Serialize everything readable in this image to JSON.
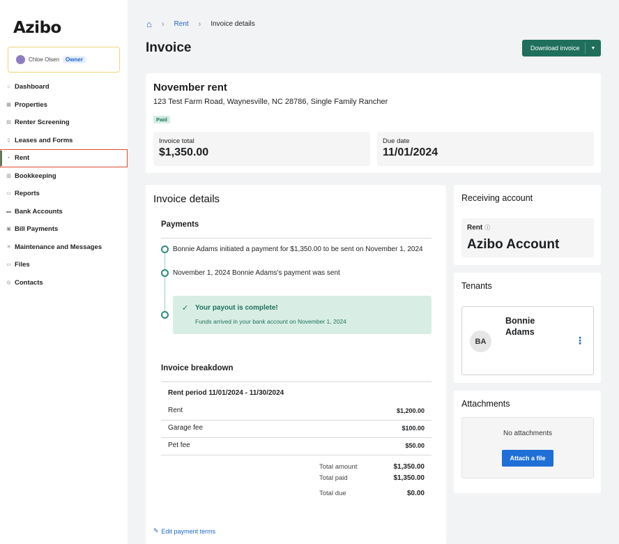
{
  "sidebar": {
    "logo": "Azibo",
    "user_name": "Chloe Olsen",
    "user_role": "Owner",
    "items": [
      {
        "label": "Dashboard",
        "icon": "home-icon"
      },
      {
        "label": "Properties",
        "icon": "building-icon"
      },
      {
        "label": "Renter Screening",
        "icon": "screening-icon"
      },
      {
        "label": "Leases and Forms",
        "icon": "document-icon"
      },
      {
        "label": "Rent",
        "icon": "rent-icon"
      },
      {
        "label": "Bookkeeping",
        "icon": "ledger-icon"
      },
      {
        "label": "Reports",
        "icon": "report-icon"
      },
      {
        "label": "Bank Accounts",
        "icon": "bank-icon"
      },
      {
        "label": "Bill Payments",
        "icon": "bill-icon"
      },
      {
        "label": "Maintenance and Messages",
        "icon": "tools-icon"
      },
      {
        "label": "Files",
        "icon": "folder-icon"
      },
      {
        "label": "Contacts",
        "icon": "contacts-icon"
      }
    ]
  },
  "breadcrumb": {
    "parent": "Rent",
    "current": "Invoice details"
  },
  "page": {
    "title": "Invoice",
    "download_label": "Download invoice"
  },
  "summary": {
    "title": "November rent",
    "address": "123 Test Farm Road, Waynesville, NC 28786, Single Family Rancher",
    "status": "Paid",
    "invoice_total_label": "Invoice total",
    "invoice_total": "$1,350.00",
    "due_date_label": "Due date",
    "due_date": "11/01/2024"
  },
  "details": {
    "title": "Invoice details",
    "payments_title": "Payments",
    "events": [
      "Bonnie Adams initiated a payment for $1,350.00 to be sent on November 1, 2024",
      "November 1, 2024 Bonnie Adams's payment was sent"
    ],
    "payout_title": "Your payout is complete!",
    "payout_sub": "Funds arrived in your bank account on November 1, 2024",
    "breakdown_title": "Invoice breakdown",
    "period": "Rent period 11/01/2024 - 11/30/2024",
    "lines": [
      {
        "label": "Rent",
        "value": "$1,200.00"
      },
      {
        "label": "Garage fee",
        "value": "$100.00"
      },
      {
        "label": "Pet fee",
        "value": "$50.00"
      }
    ],
    "totals": [
      {
        "label": "Total amount",
        "value": "$1,350.00"
      },
      {
        "label": "Total paid",
        "value": "$1,350.00"
      },
      {
        "label": "Total due",
        "value": "$0.00"
      }
    ],
    "edit_link": "Edit payment terms"
  },
  "receiving": {
    "title": "Receiving account",
    "label": "Rent",
    "account": "Azibo Account"
  },
  "tenants": {
    "title": "Tenants",
    "initials": "BA",
    "name": "Bonnie Adams"
  },
  "attachments": {
    "title": "Attachments",
    "empty": "No attachments",
    "button": "Attach a file"
  }
}
